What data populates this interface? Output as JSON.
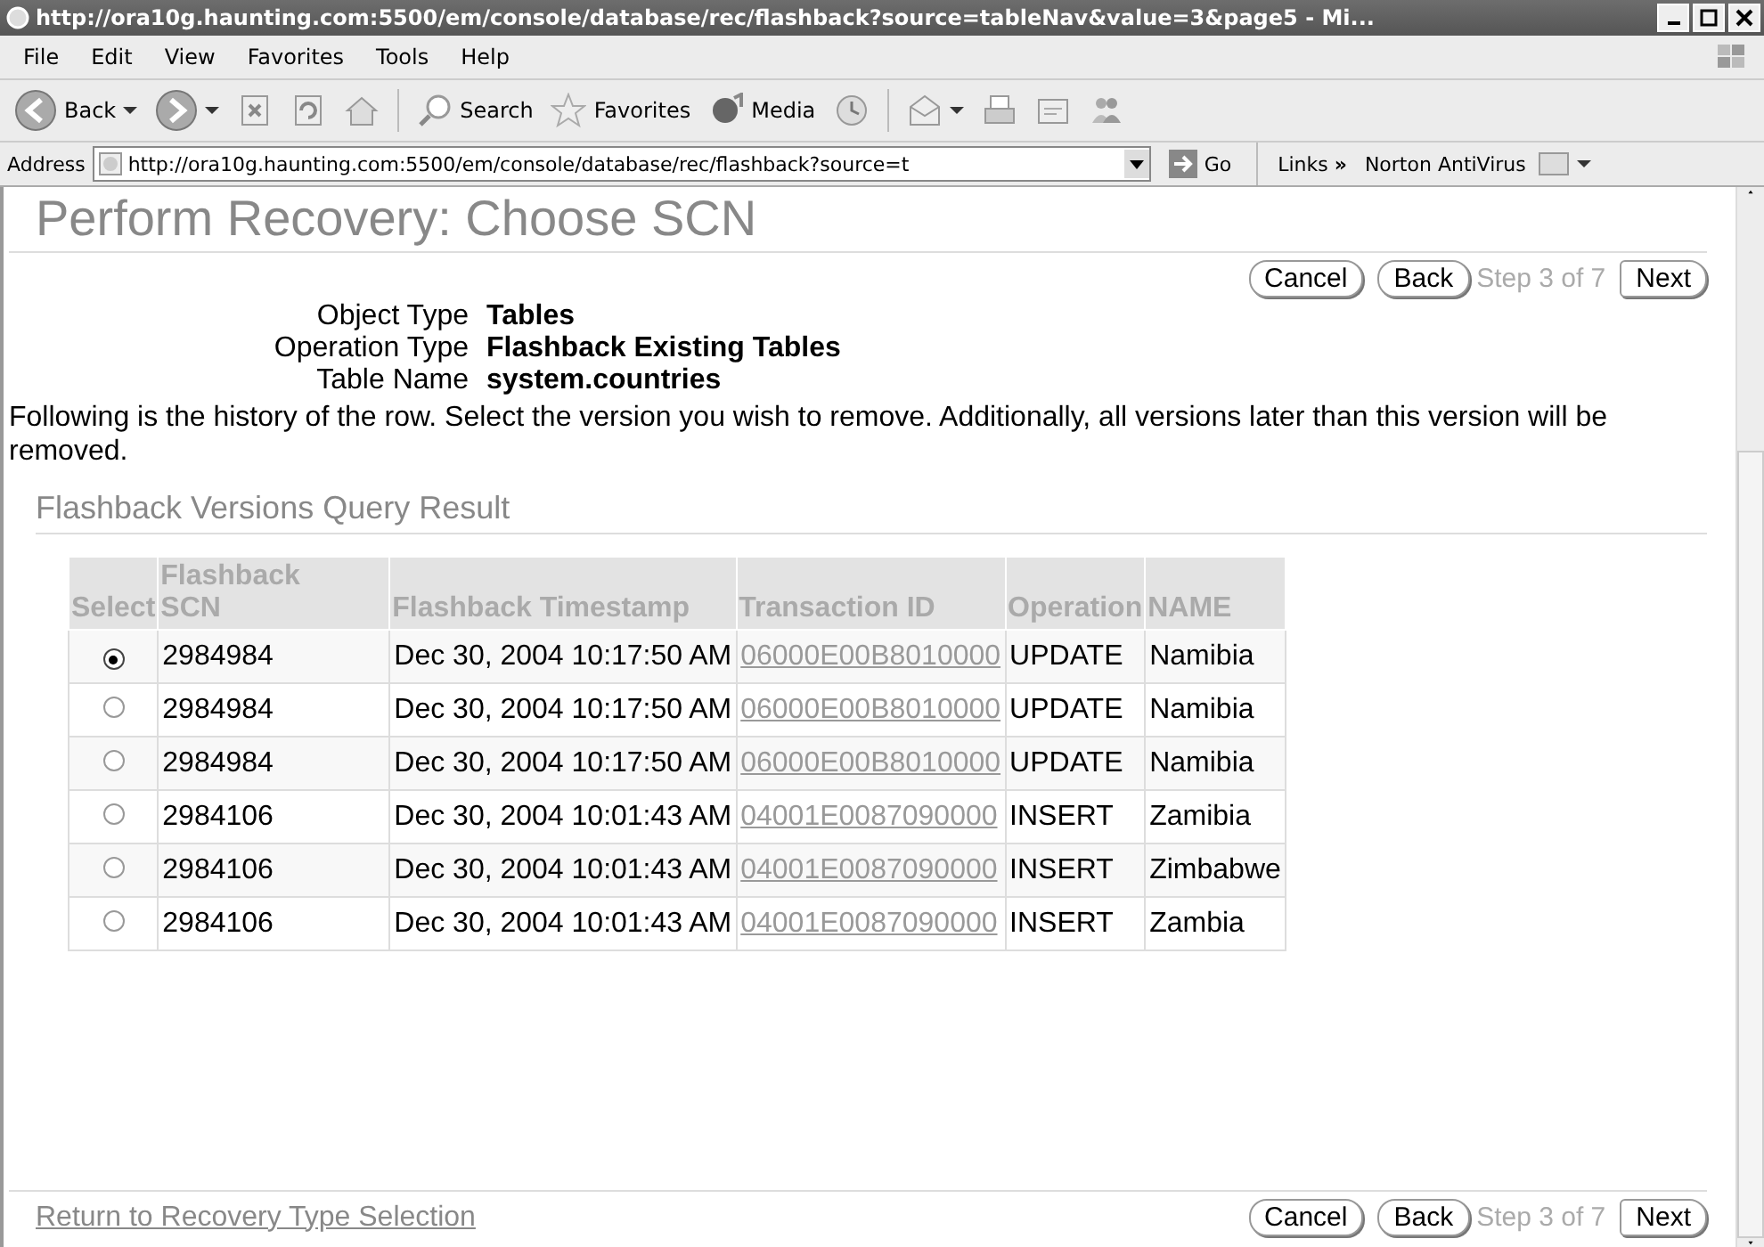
{
  "window": {
    "title": "http://ora10g.haunting.com:5500/em/console/database/rec/flashback?source=tableNav&value=3&page5 - Mi..."
  },
  "menu": [
    "File",
    "Edit",
    "View",
    "Favorites",
    "Tools",
    "Help"
  ],
  "toolbar": [
    {
      "kind": "back",
      "label": "Back"
    },
    {
      "kind": "forward"
    },
    {
      "kind": "stop"
    },
    {
      "kind": "refresh"
    },
    {
      "kind": "home"
    },
    {
      "kind": "search",
      "label": "Search"
    },
    {
      "kind": "favorites",
      "label": "Favorites"
    },
    {
      "kind": "media",
      "label": "Media"
    },
    {
      "kind": "history"
    },
    {
      "kind": "mail"
    },
    {
      "kind": "print"
    },
    {
      "kind": "edit"
    },
    {
      "kind": "messenger"
    }
  ],
  "address": {
    "label": "Address",
    "url": "http://ora10g.haunting.com:5500/em/console/database/rec/flashback?source=t",
    "go": "Go",
    "links": "Links",
    "links_more": "»",
    "toolbar_name": "Norton AntiVirus"
  },
  "page": {
    "title": "Perform Recovery: Choose SCN",
    "nav_top": {
      "cancel": "Cancel",
      "back": "Back",
      "step": "Step 3 of 7",
      "next": "Next"
    },
    "info": [
      {
        "label": "Object Type",
        "value": "Tables"
      },
      {
        "label": "Operation Type",
        "value": "Flashback Existing Tables"
      },
      {
        "label": "Table Name",
        "value": "system.countries"
      }
    ],
    "description": "Following is the history of the row. Select the version you wish to remove. Additionally, all versions later than this version will be removed.",
    "section_title": "Flashback Versions Query Result",
    "table": {
      "columns": [
        "Select",
        "Flashback SCN",
        "Flashback Timestamp",
        "Transaction ID",
        "Operation",
        "NAME"
      ],
      "rows": [
        {
          "selected": true,
          "scn": "2984984",
          "timestamp": "Dec 30, 2004 10:17:50 AM",
          "transaction_id": "06000E00B8010000",
          "operation": "UPDATE",
          "name": "Namibia"
        },
        {
          "selected": false,
          "scn": "2984984",
          "timestamp": "Dec 30, 2004 10:17:50 AM",
          "transaction_id": "06000E00B8010000",
          "operation": "UPDATE",
          "name": "Namibia"
        },
        {
          "selected": false,
          "scn": "2984984",
          "timestamp": "Dec 30, 2004 10:17:50 AM",
          "transaction_id": "06000E00B8010000",
          "operation": "UPDATE",
          "name": "Namibia"
        },
        {
          "selected": false,
          "scn": "2984106",
          "timestamp": "Dec 30, 2004 10:01:43 AM",
          "transaction_id": "04001E0087090000",
          "operation": "INSERT",
          "name": "Zamibia"
        },
        {
          "selected": false,
          "scn": "2984106",
          "timestamp": "Dec 30, 2004 10:01:43 AM",
          "transaction_id": "04001E0087090000",
          "operation": "INSERT",
          "name": "Zimbabwe"
        },
        {
          "selected": false,
          "scn": "2984106",
          "timestamp": "Dec 30, 2004 10:01:43 AM",
          "transaction_id": "04001E0087090000",
          "operation": "INSERT",
          "name": "Zambia"
        }
      ]
    },
    "footer_link": "Return to Recovery Type Selection",
    "nav_bottom": {
      "cancel": "Cancel",
      "back": "Back",
      "step": "Step 3 of 7",
      "next": "Next"
    }
  }
}
